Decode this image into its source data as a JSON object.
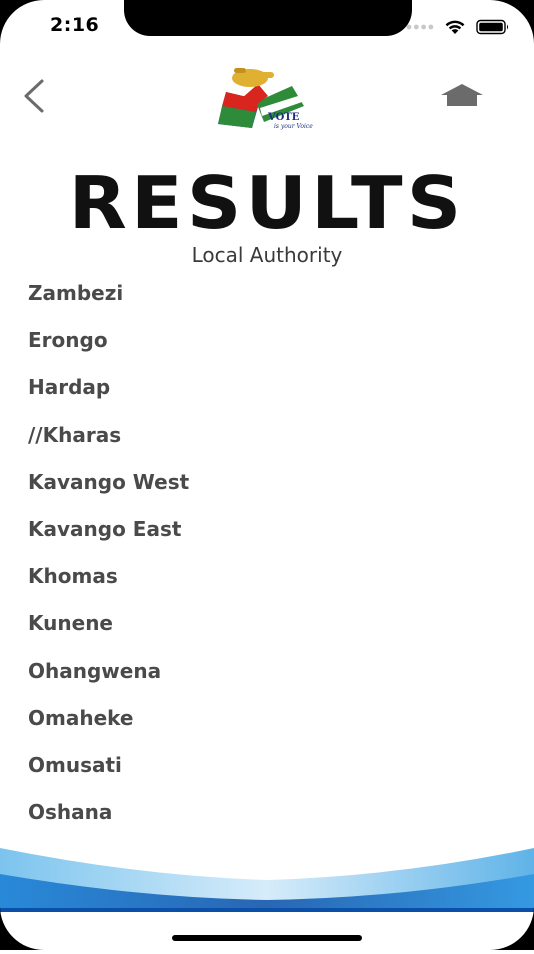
{
  "status_bar": {
    "time": "2:16"
  },
  "header": {
    "back_icon": "chevron-left-icon",
    "home_icon": "home-roof-icon",
    "logo_tagline": "is your Voice",
    "logo_word": "VOTE"
  },
  "page": {
    "title": "RESULTS",
    "subtitle": "Local Authority"
  },
  "regions": [
    {
      "label": "Zambezi"
    },
    {
      "label": "Erongo"
    },
    {
      "label": "Hardap"
    },
    {
      "label": "//Kharas"
    },
    {
      "label": "Kavango West"
    },
    {
      "label": "Kavango East"
    },
    {
      "label": "Khomas"
    },
    {
      "label": "Kunene"
    },
    {
      "label": "Ohangwena"
    },
    {
      "label": "Omaheke"
    },
    {
      "label": "Omusati"
    },
    {
      "label": "Oshana"
    }
  ],
  "colors": {
    "title": "#111111",
    "list_text": "#4a4a4a",
    "wave_dark": "#0a4fa8",
    "wave_light": "#5fb3e8",
    "home_icon": "#6b6b6b"
  }
}
